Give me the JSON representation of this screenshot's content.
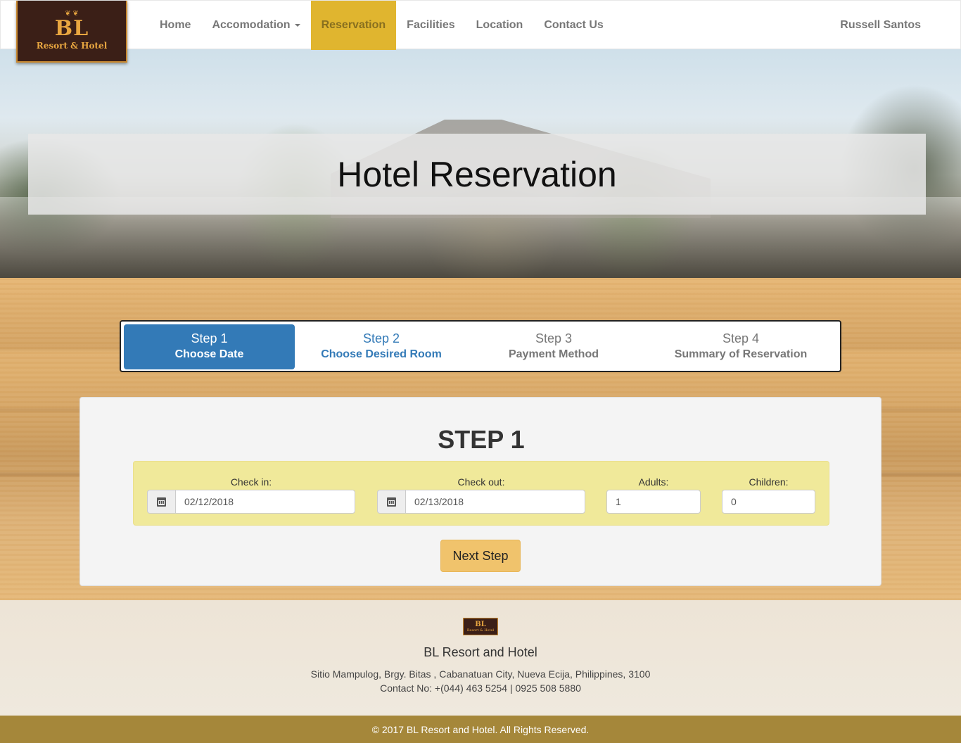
{
  "brand": {
    "logo_main": "BL",
    "logo_sub": "Resort & Hotel",
    "logo_ornament": "❦ ❦"
  },
  "nav": {
    "items": [
      {
        "label": "Home"
      },
      {
        "label": "Accomodation"
      },
      {
        "label": "Reservation"
      },
      {
        "label": "Facilities"
      },
      {
        "label": "Location"
      },
      {
        "label": "Contact Us"
      }
    ],
    "active": "Reservation",
    "user": "Russell Santos"
  },
  "hero": {
    "title": "Hotel Reservation"
  },
  "steps": [
    {
      "num": "Step 1",
      "label": "Choose Date",
      "state": "active"
    },
    {
      "num": "Step 2",
      "label": "Choose Desired Room",
      "state": "link"
    },
    {
      "num": "Step 3",
      "label": "Payment Method",
      "state": "disabled"
    },
    {
      "num": "Step 4",
      "label": "Summary of Reservation",
      "state": "disabled"
    }
  ],
  "form": {
    "title": "STEP 1",
    "checkin": {
      "label": "Check in:",
      "value": "02/12/2018",
      "icon": "calendar-icon"
    },
    "checkout": {
      "label": "Check out:",
      "value": "02/13/2018",
      "icon": "calendar-icon"
    },
    "adults": {
      "label": "Adults:",
      "value": "1"
    },
    "children": {
      "label": "Children:",
      "value": "0"
    },
    "next_label": "Next Step"
  },
  "footer": {
    "logo_main": "BL",
    "logo_sub": "Resort & Hotel",
    "name": "BL Resort and Hotel",
    "address": "Sitio Mampulog, Brgy. Bitas , Cabanatuan City, Nueva Ecija, Philippines, 3100",
    "contact": "Contact No: +(044) 463 5254 | 0925 508 5880",
    "copyright": "© 2017 BL Resort and Hotel. All Rights Reserved."
  },
  "colors": {
    "nav_active": "#e0b52f",
    "step_active": "#337ab7",
    "form_bg": "#f0e99a",
    "next_button": "#f0c36c",
    "copyright_bar": "#a5873a"
  }
}
